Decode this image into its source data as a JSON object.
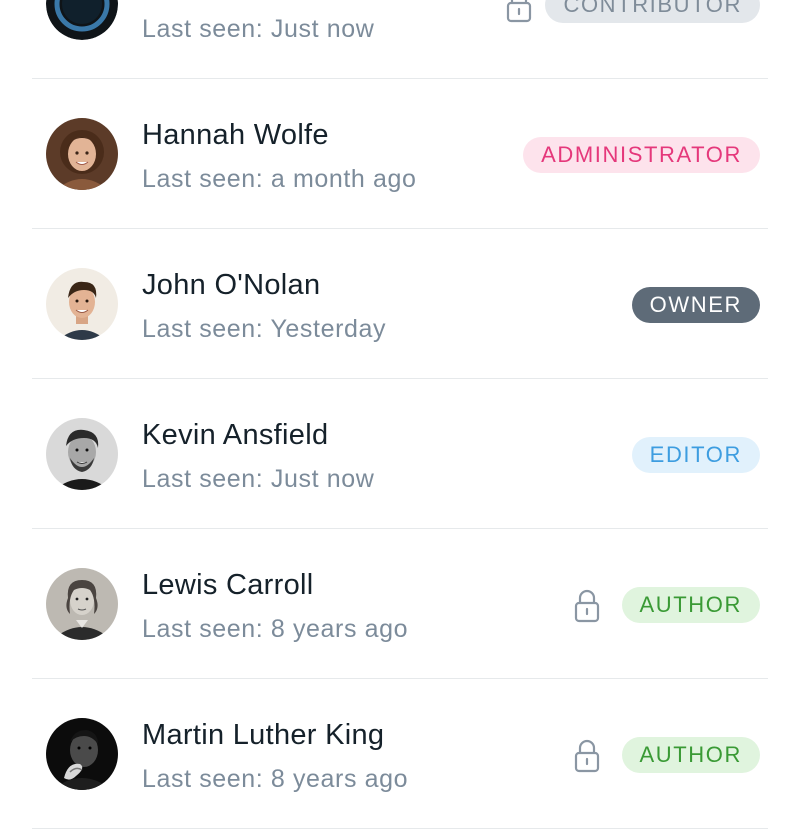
{
  "users": [
    {
      "name": "",
      "last_seen": "Last seen: Just now",
      "role": "CONTRIBUTOR",
      "role_style": "contributor",
      "suspended": true,
      "avatar": "dark-ring-avatar"
    },
    {
      "name": "Hannah Wolfe",
      "last_seen": "Last seen: a month ago",
      "role": "ADMINISTRATOR",
      "role_style": "administrator",
      "suspended": false,
      "avatar": "woman-portrait-avatar"
    },
    {
      "name": "John O'Nolan",
      "last_seen": "Last seen: Yesterday",
      "role": "OWNER",
      "role_style": "owner",
      "suspended": false,
      "avatar": "man-portrait-avatar"
    },
    {
      "name": "Kevin Ansfield",
      "last_seen": "Last seen: Just now",
      "role": "EDITOR",
      "role_style": "editor",
      "suspended": false,
      "avatar": "bw-bearded-man-avatar"
    },
    {
      "name": "Lewis Carroll",
      "last_seen": "Last seen: 8 years ago",
      "role": "AUTHOR",
      "role_style": "author",
      "suspended": true,
      "avatar": "bw-victorian-portrait-avatar"
    },
    {
      "name": "Martin Luther King",
      "last_seen": "Last seen: 8 years ago",
      "role": "AUTHOR",
      "role_style": "author",
      "suspended": true,
      "avatar": "bw-man-portrait-avatar"
    }
  ],
  "colors": {
    "name_text": "#15212a",
    "meta_text": "#7c8b9a",
    "divider": "#e6e9eb",
    "lock_icon": "#8a96a3"
  },
  "icons": {
    "lock": "lock-icon"
  }
}
